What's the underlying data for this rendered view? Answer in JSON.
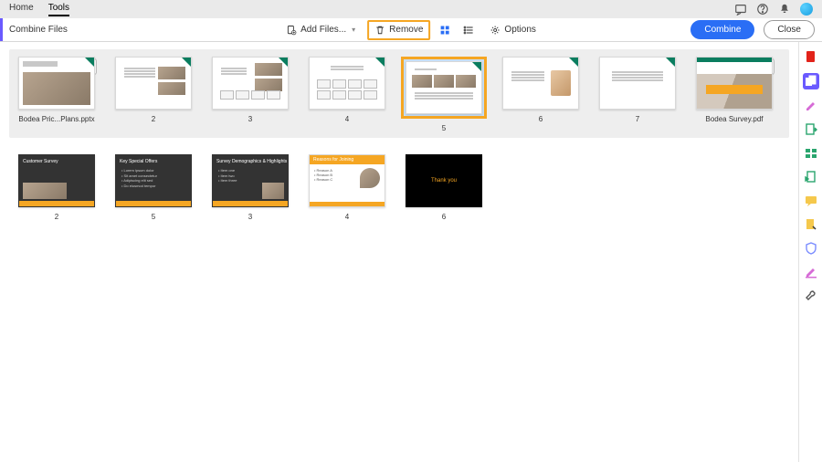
{
  "menu": {
    "home": "Home",
    "tools": "Tools"
  },
  "toolbar": {
    "title": "Combine Files",
    "add_files": "Add Files...",
    "remove": "Remove",
    "options": "Options",
    "combine": "Combine",
    "close": "Close"
  },
  "row1": {
    "file1_caption": "Bodea Pric...Plans.pptx",
    "captions": [
      "2",
      "3",
      "4",
      "5",
      "6",
      "7"
    ],
    "file2_caption": "Bodea Survey.pdf"
  },
  "row2": {
    "captions": [
      "2",
      "5",
      "3",
      "4",
      "6"
    ],
    "slide1_title": "Customer Survey",
    "slide2_title": "Key Special Offers",
    "slide3_title": "Survey Demographics & Highlights",
    "slide4_title": "Reasons for Joining",
    "slide5_center": "Thank you"
  },
  "icons": {
    "expand": "⊕"
  }
}
